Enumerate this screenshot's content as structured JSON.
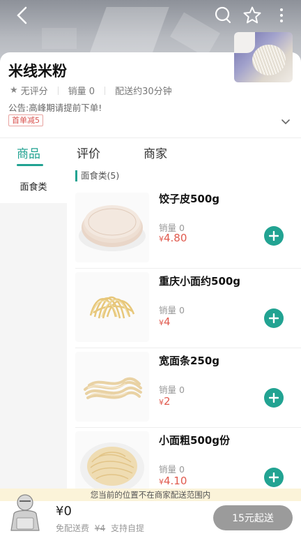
{
  "header": {
    "back_icon": "chevron-left-icon",
    "search_icon": "search-icon",
    "favorite_icon": "star-outline-icon",
    "more_icon": "more-vertical-icon"
  },
  "shop": {
    "name": "米线米粉",
    "rating": "无评分",
    "sales": "销量 0",
    "delivery": "配送约30分钟",
    "notice": "公告:高峰期请提前下单!",
    "promo": "首单减5"
  },
  "tabs": [
    {
      "label": "商品",
      "active": true
    },
    {
      "label": "评价",
      "active": false
    },
    {
      "label": "商家",
      "active": false
    }
  ],
  "sidebar": {
    "items": [
      {
        "label": "面食类",
        "active": true
      }
    ]
  },
  "category": {
    "title": "面食类(5)"
  },
  "products": [
    {
      "name": "饺子皮500g",
      "sales": "销量 0",
      "currency": "¥",
      "price": "4.80",
      "image": "dumpling-wrappers"
    },
    {
      "name": "重庆小面约500g",
      "sales": "销量 0",
      "currency": "¥",
      "price": "4",
      "image": "chongqing-noodles"
    },
    {
      "name": "宽面条250g",
      "sales": "销量 0",
      "currency": "¥",
      "price": "2",
      "image": "wide-noodles"
    },
    {
      "name": "小面粗500g份",
      "sales": "销量 0",
      "currency": "¥",
      "price": "4.10",
      "image": "thick-noodles"
    }
  ],
  "banner": {
    "out_of_range": "您当前的位置不在商家配送范围内"
  },
  "cart": {
    "total": "¥0",
    "free_delivery": "免配送费",
    "original_fee": "¥4",
    "self_pickup": "支持自提",
    "checkout_label": "15元起送"
  },
  "colors": {
    "accent": "#22a392",
    "price": "#e05a4e",
    "checkout_disabled": "#9b9b9b",
    "warning_bg": "#fbf3d9"
  }
}
